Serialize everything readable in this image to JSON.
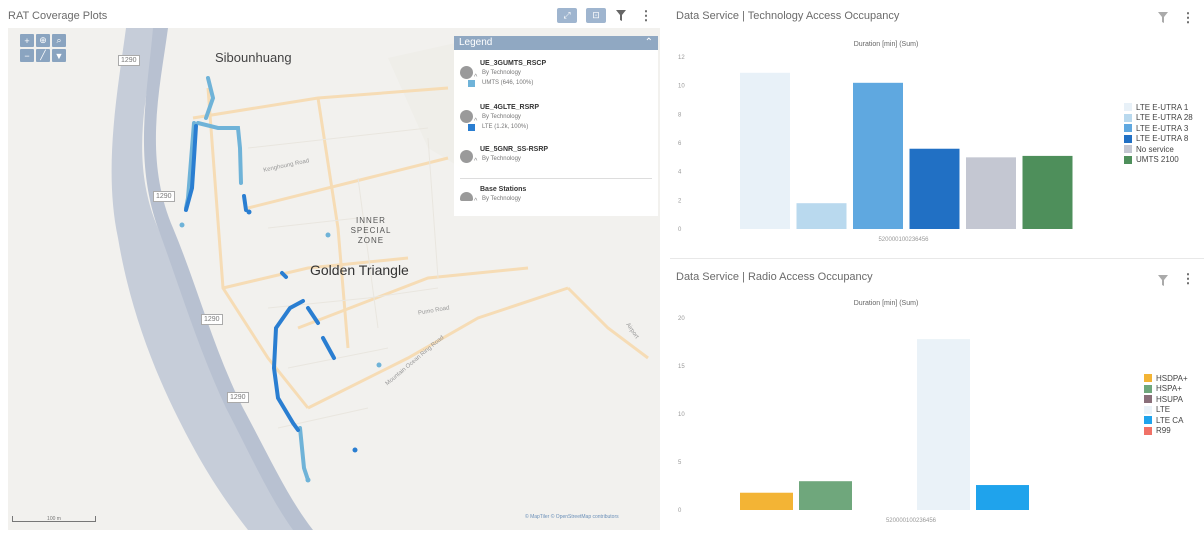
{
  "map_panel": {
    "title": "RAT Coverage Plots",
    "legend": {
      "header": "Legend",
      "items": [
        {
          "name": "UE_3GUMTS_RSCP",
          "sub": "By Technology",
          "swatch_label": "UMTS (646, 100%)",
          "swatch_color": "#6fb3d8"
        },
        {
          "name": "UE_4GLTE_RSRP",
          "sub": "By Technology",
          "swatch_label": "LTE (1.2k, 100%)",
          "swatch_color": "#2a7ed1"
        },
        {
          "name": "UE_5GNR_SS-RSRP",
          "sub": "By Technology"
        },
        {
          "name": "Base Stations",
          "sub": "By Technology"
        }
      ]
    },
    "labels": {
      "sibounhuang": "Sibounhuang",
      "golden_triangle": "Golden Triangle",
      "zone_line1": "INNER SPECIAL",
      "zone_line2": "ZONE"
    },
    "shields": [
      "1290",
      "1290",
      "1290",
      "1290"
    ],
    "roads": {
      "r1": "Kenghoung Road",
      "r2": "Pumo Road",
      "r3": "Mountain Ocean Ring Road",
      "r4": "Airport"
    },
    "scale": "100 m",
    "attribution": "© MapTiler © OpenStreetMap contributors"
  },
  "chart1": {
    "title": "Data Service | Technology Access Occupancy",
    "subtitle": "Duration [min] (Sum)"
  },
  "chart2": {
    "title": "Data Service | Radio Access Occupancy",
    "subtitle": "Duration [min] (Sum)"
  },
  "chart_data": [
    {
      "type": "bar",
      "title": "Duration [min] (Sum)",
      "xlabel": "520000100236456",
      "categories": [
        "520000100236456"
      ],
      "ylim": [
        0,
        12
      ],
      "yticks": [
        0,
        2,
        4,
        6,
        8,
        10,
        12
      ],
      "legend_position": "right",
      "series": [
        {
          "name": "LTE E-UTRA 1",
          "values": [
            10.9
          ],
          "color": "#e8f1f8"
        },
        {
          "name": "LTE E-UTRA 28",
          "values": [
            1.8
          ],
          "color": "#b9d9ee"
        },
        {
          "name": "LTE E-UTRA 3",
          "values": [
            10.2
          ],
          "color": "#5fa8e0"
        },
        {
          "name": "LTE E-UTRA 8",
          "values": [
            5.6
          ],
          "color": "#2170c4"
        },
        {
          "name": "No service",
          "values": [
            5.0
          ],
          "color": "#c4c7d2"
        },
        {
          "name": "UMTS 2100",
          "values": [
            5.1
          ],
          "color": "#4e8f5b"
        }
      ]
    },
    {
      "type": "bar",
      "title": "Duration [min] (Sum)",
      "xlabel": "520000100236456",
      "categories": [
        "520000100236456"
      ],
      "ylim": [
        0,
        20
      ],
      "yticks": [
        0,
        5,
        10,
        15,
        20
      ],
      "legend_position": "right",
      "series": [
        {
          "name": "HSDPA+",
          "values": [
            1.8
          ],
          "color": "#f3b435"
        },
        {
          "name": "HSPA+",
          "values": [
            3.0
          ],
          "color": "#6fa77c"
        },
        {
          "name": "HSUPA",
          "values": [
            0.0
          ],
          "color": "#8a6f7a"
        },
        {
          "name": "LTE",
          "values": [
            17.8
          ],
          "color": "#eaf2f8"
        },
        {
          "name": "LTE CA",
          "values": [
            2.6
          ],
          "color": "#1fa3ec"
        },
        {
          "name": "R99",
          "values": [
            0.0
          ],
          "color": "#f07167"
        }
      ]
    }
  ]
}
